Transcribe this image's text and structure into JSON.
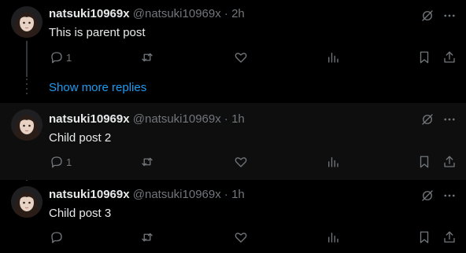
{
  "posts": [
    {
      "name": "natsuki10969x",
      "handle": "@natsuki10969x",
      "sep": "·",
      "time": "2h",
      "text": "This is parent post",
      "reply_count": "1"
    },
    {
      "name": "natsuki10969x",
      "handle": "@natsuki10969x",
      "sep": "·",
      "time": "1h",
      "text": "Child post 2",
      "reply_count": "1"
    },
    {
      "name": "natsuki10969x",
      "handle": "@natsuki10969x",
      "sep": "·",
      "time": "1h",
      "text": "Child post 3",
      "reply_count": ""
    }
  ],
  "show_more_replies": "Show more replies",
  "icons": [
    "grok-icon",
    "more-icon",
    "reply-icon",
    "repost-icon",
    "like-icon",
    "views-icon",
    "bookmark-icon",
    "share-icon"
  ],
  "colors": {
    "background": "#000000",
    "muted": "#71767b",
    "link": "#1d9bf0",
    "text": "#e7e9ea"
  }
}
